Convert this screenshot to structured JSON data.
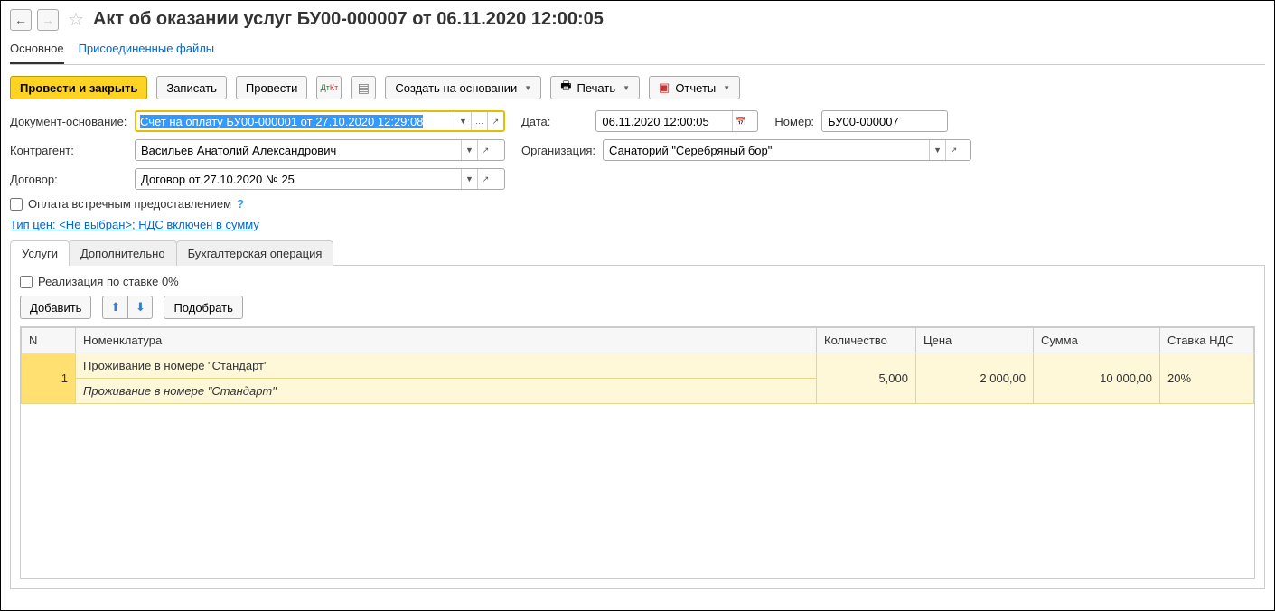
{
  "title": "Акт об оказании услуг БУ00-000007 от 06.11.2020 12:00:05",
  "mainTabs": {
    "main": "Основное",
    "files": "Присоединенные файлы"
  },
  "toolbar": {
    "postClose": "Провести и закрыть",
    "write": "Записать",
    "post": "Провести",
    "createBased": "Создать на основании",
    "print": "Печать",
    "reports": "Отчеты"
  },
  "labels": {
    "basis": "Документ-основание:",
    "date": "Дата:",
    "number": "Номер:",
    "counterparty": "Контрагент:",
    "organization": "Организация:",
    "contract": "Договор:",
    "counterPayment": "Оплата встречным предоставлением",
    "priceType": "Тип цен: <Не выбран>; НДС включен в сумму",
    "zeroRate": "Реализация по ставке 0%",
    "add": "Добавить",
    "pick": "Подобрать"
  },
  "fields": {
    "basis": "Счет на оплату БУ00-000001 от 27.10.2020 12:29:08",
    "date": "06.11.2020 12:00:05",
    "number": "БУ00-000007",
    "counterparty": "Васильев Анатолий Александрович",
    "organization": "Санаторий \"Серебряный бор\"",
    "contract": "Договор от 27.10.2020 № 25"
  },
  "innerTabs": {
    "services": "Услуги",
    "more": "Дополнительно",
    "accounting": "Бухгалтерская операция"
  },
  "grid": {
    "headers": {
      "n": "N",
      "nom": "Номенклатура",
      "qty": "Количество",
      "price": "Цена",
      "sum": "Сумма",
      "vatRate": "Ставка НДС"
    },
    "rows": [
      {
        "n": "1",
        "nom": "Проживание в номере \"Стандарт\"",
        "nomSub": "Проживание в номере \"Стандарт\"",
        "qty": "5,000",
        "price": "2 000,00",
        "sum": "10 000,00",
        "vatRate": "20%"
      }
    ]
  }
}
